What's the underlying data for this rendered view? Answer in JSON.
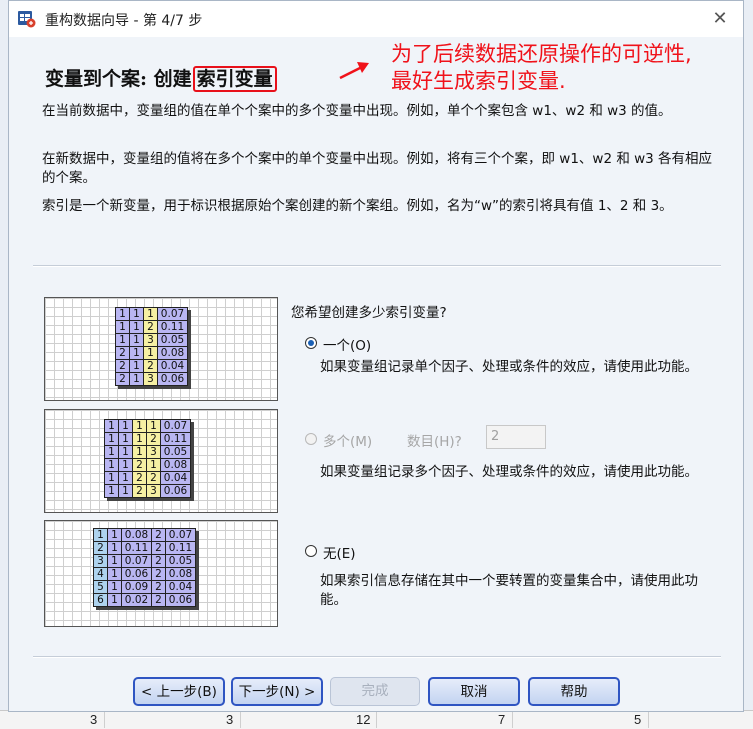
{
  "background_sheet": {
    "values": [
      "3",
      "3",
      "12",
      "7",
      "5"
    ]
  },
  "window": {
    "title": "重构数据向导 - 第 4/7 步",
    "close_glyph": "✕",
    "app_icon": "spss-table-icon"
  },
  "heading": {
    "prefix": "变量到个案: 创建",
    "highlight": "索引变量"
  },
  "annotation": {
    "line1": "为了后续数据还原操作的可逆性,",
    "line2": "最好生成索引变量.",
    "color": "#f0121a"
  },
  "paragraphs": [
    "在当前数据中，变量组的值在单个个案中的多个变量中出现。例如，单个个案包含 w1、w2 和 w3 的值。",
    "在新数据中，变量组的值将在多个个案中的单个变量中出现。例如，将有三个个案，即 w1、w2 和 w3 各有相应的个案。",
    "索引是一个新变量，用于标识根据原始个案创建的新个案组。例如，名为“w”的索引将具有值 1、2 和 3。"
  ],
  "illustrations": {
    "one_index": [
      [
        "1",
        "1",
        "1",
        "0.07"
      ],
      [
        "1",
        "1",
        "2",
        "0.11"
      ],
      [
        "1",
        "1",
        "3",
        "0.05"
      ],
      [
        "2",
        "1",
        "1",
        "0.08"
      ],
      [
        "2",
        "1",
        "2",
        "0.04"
      ],
      [
        "2",
        "1",
        "3",
        "0.06"
      ]
    ],
    "multiple_index": [
      [
        "1",
        "1",
        "1",
        "1",
        "0.07"
      ],
      [
        "1",
        "1",
        "1",
        "2",
        "0.11"
      ],
      [
        "1",
        "1",
        "1",
        "3",
        "0.05"
      ],
      [
        "1",
        "1",
        "2",
        "1",
        "0.08"
      ],
      [
        "1",
        "1",
        "2",
        "2",
        "0.04"
      ],
      [
        "1",
        "1",
        "2",
        "3",
        "0.06"
      ]
    ],
    "no_index": [
      [
        "1",
        "1",
        "0.08",
        "2",
        "0.07"
      ],
      [
        "2",
        "1",
        "0.11",
        "2",
        "0.11"
      ],
      [
        "3",
        "1",
        "0.07",
        "2",
        "0.05"
      ],
      [
        "4",
        "1",
        "0.06",
        "2",
        "0.08"
      ],
      [
        "5",
        "1",
        "0.09",
        "2",
        "0.04"
      ],
      [
        "6",
        "1",
        "0.02",
        "2",
        "0.06"
      ]
    ]
  },
  "question": "您希望创建多少索引变量?",
  "options": {
    "one": {
      "label": "一个(O)",
      "description": "如果变量组记录单个因子、处理或条件的效应，请使用此功能。",
      "selected": true
    },
    "multiple": {
      "label": "多个(M)",
      "count_label": "数目(H)?",
      "count_value": "2",
      "description": "如果变量组记录多个因子、处理或条件的效应，请使用此功能。",
      "enabled": false
    },
    "none": {
      "label": "无(E)",
      "description": "如果索引信息存储在其中一个要转置的变量集合中，请使用此功能。"
    }
  },
  "buttons": {
    "back": "< 上一步(B)",
    "next": "下一步(N) >",
    "finish": "完成",
    "cancel": "取消",
    "help": "帮助"
  }
}
